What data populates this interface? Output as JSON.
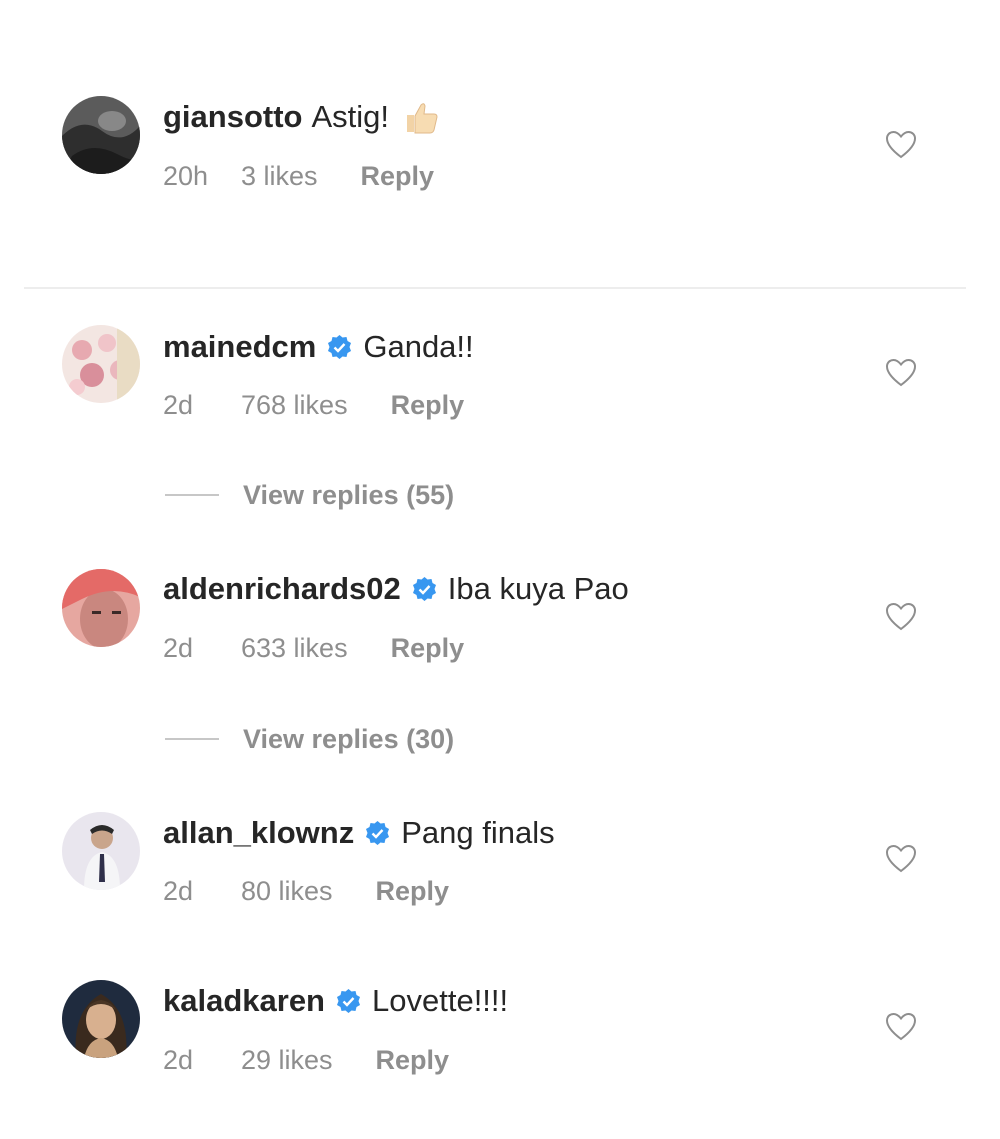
{
  "comments": [
    {
      "username": "giansotto",
      "text": "Astig!",
      "emoji_icon": "thumbs-up-icon",
      "verified": false,
      "time": "20h",
      "likes": "3 likes",
      "reply": "Reply"
    },
    {
      "username": "mainedcm",
      "text": "Ganda!!",
      "verified": true,
      "time": "2d",
      "likes": "768 likes",
      "reply": "Reply",
      "view_replies": "View replies (55)"
    },
    {
      "username": "aldenrichards02",
      "text": "Iba kuya Pao",
      "verified": true,
      "time": "2d",
      "likes": "633 likes",
      "reply": "Reply",
      "view_replies": "View replies (30)"
    },
    {
      "username": "allan_klownz",
      "text": "Pang finals",
      "verified": true,
      "time": "2d",
      "likes": "80 likes",
      "reply": "Reply"
    },
    {
      "username": "kaladkaren",
      "text": "Lovette!!!!",
      "verified": true,
      "time": "2d",
      "likes": "29 likes",
      "reply": "Reply"
    }
  ],
  "colors": {
    "text": "#262626",
    "meta": "#8e8e8e",
    "verified": "#3897f0",
    "divider": "#ededed"
  },
  "icons": {
    "like": "heart-outline-icon",
    "verified": "verified-badge-icon"
  }
}
